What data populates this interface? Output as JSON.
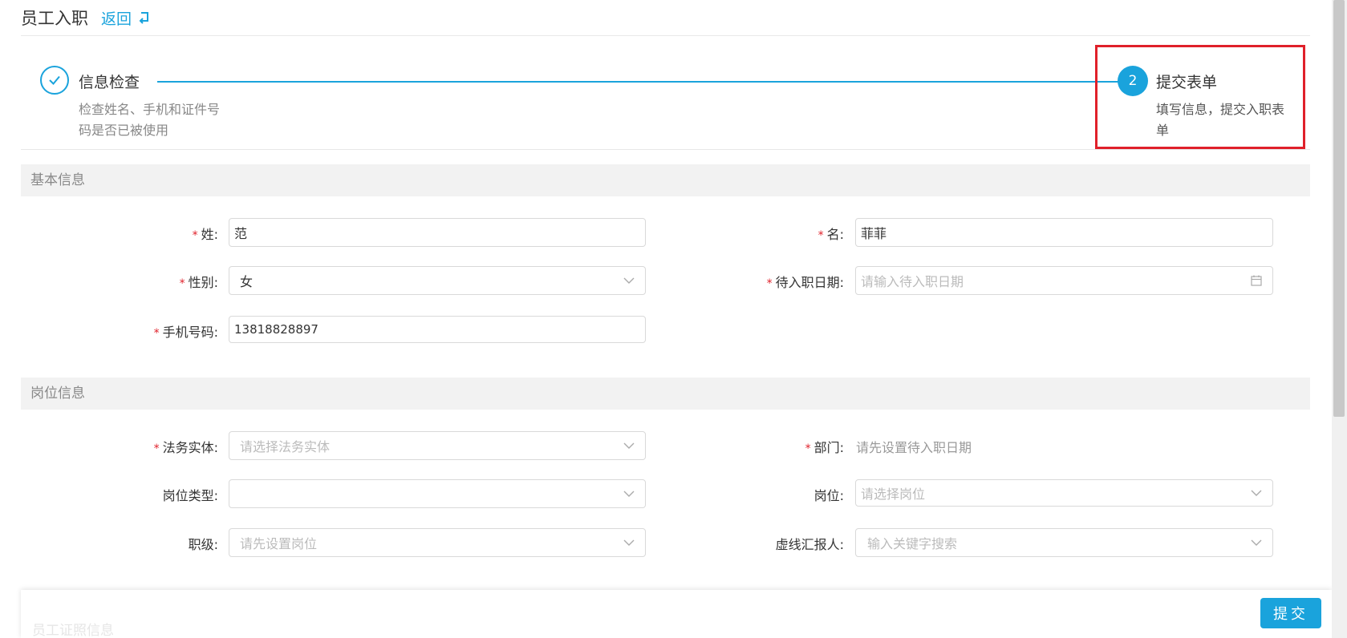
{
  "header": {
    "title": "员工入职",
    "back_label": "返回"
  },
  "steps": [
    {
      "index": "1",
      "title": "信息检查",
      "description": "检查姓名、手机和证件号码是否已被使用",
      "status": "done"
    },
    {
      "index": "2",
      "title": "提交表单",
      "description": "填写信息，提交入职表单",
      "status": "active"
    }
  ],
  "sections": {
    "basic": "基本信息",
    "position": "岗位信息"
  },
  "form": {
    "last_name": {
      "label": "姓:",
      "value": "范"
    },
    "first_name": {
      "label": "名:",
      "value": "菲菲"
    },
    "gender": {
      "label": "性别:",
      "value": "女"
    },
    "entry_date": {
      "label": "待入职日期:",
      "placeholder": "请输入待入职日期"
    },
    "phone": {
      "label": "手机号码:",
      "value": "13818828897"
    },
    "legal_entity": {
      "label": "法务实体:",
      "placeholder": "请选择法务实体"
    },
    "department": {
      "label": "部门:",
      "hint": "请先设置待入职日期"
    },
    "position_type": {
      "label": "岗位类型:",
      "value": ""
    },
    "position": {
      "label": "岗位:",
      "placeholder": "请选择岗位"
    },
    "level": {
      "label": "职级:",
      "placeholder": "请先设置岗位"
    },
    "dotted_line_report": {
      "label": "虚线汇报人:",
      "placeholder": "输入关键字搜索"
    }
  },
  "footer": {
    "submit_label": "提交",
    "faded_text": "员工证照信息"
  },
  "colors": {
    "accent": "#1aa3dc",
    "required": "#e0202a",
    "highlight_border": "#e0202a"
  },
  "icons": {
    "back": "return-arrow-icon",
    "check": "check-icon",
    "chevron": "chevron-down-icon",
    "calendar": "calendar-icon"
  }
}
